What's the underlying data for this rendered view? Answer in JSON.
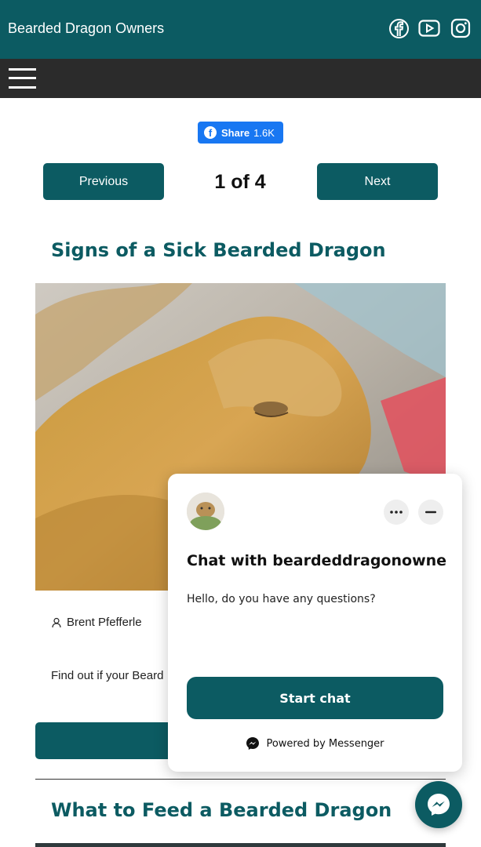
{
  "header": {
    "site_title": "Bearded Dragon Owners",
    "social_icons": [
      "facebook-icon",
      "youtube-icon",
      "instagram-icon"
    ]
  },
  "share": {
    "label": "Share",
    "count": "1.6K"
  },
  "pagination": {
    "previous_label": "Previous",
    "next_label": "Next",
    "page_indicator": "1 of 4"
  },
  "articles": [
    {
      "title": "Signs of a Sick Bearded Dragon",
      "author": "Brent Pfefferle",
      "excerpt": "Find out if your Beard"
    },
    {
      "title": "What to Feed a Bearded Dragon"
    }
  ],
  "chat": {
    "title": "Chat with beardeddragonowners....",
    "message": "Hello, do you have any questions?",
    "start_label": "Start chat",
    "powered_by": "Powered by Messenger"
  },
  "colors": {
    "brand": "#0c5b62",
    "nav": "#2b2b2b",
    "facebook": "#1877f2"
  }
}
